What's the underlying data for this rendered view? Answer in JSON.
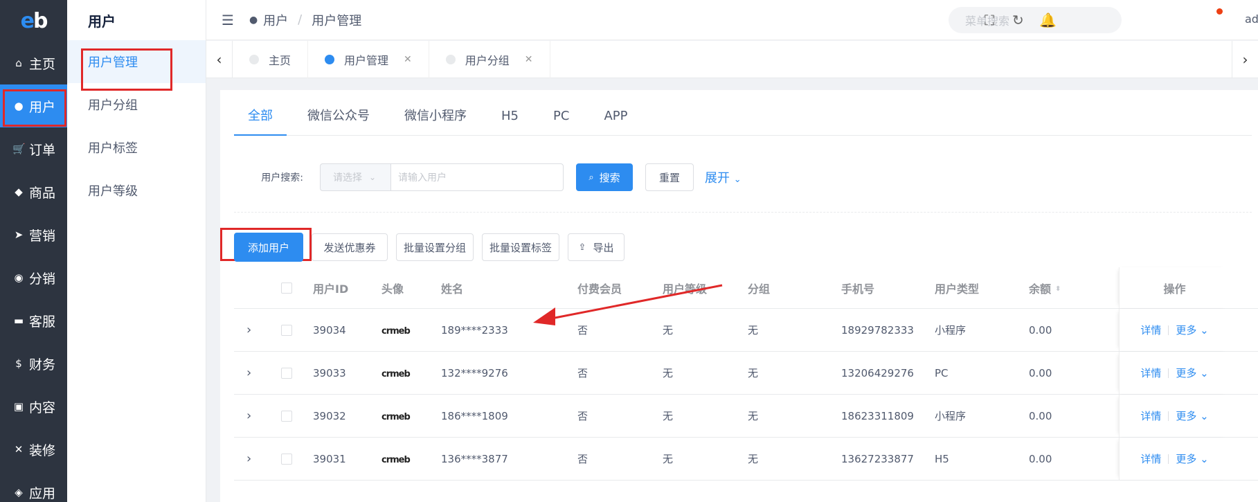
{
  "logo": {
    "text_e": "e",
    "text_b": "b"
  },
  "rail": [
    {
      "icon": "⌂",
      "label": "主页",
      "active": false
    },
    {
      "icon": "●",
      "label": "用户",
      "active": true
    },
    {
      "icon": "🛒",
      "label": "订单",
      "active": false
    },
    {
      "icon": "◆",
      "label": "商品",
      "active": false
    },
    {
      "icon": "➤",
      "label": "营销",
      "active": false
    },
    {
      "icon": "◉",
      "label": "分销",
      "active": false
    },
    {
      "icon": "▬",
      "label": "客服",
      "active": false
    },
    {
      "icon": "$",
      "label": "财务",
      "active": false
    },
    {
      "icon": "▣",
      "label": "内容",
      "active": false
    },
    {
      "icon": "✕",
      "label": "装修",
      "active": false
    },
    {
      "icon": "◈",
      "label": "应用",
      "active": false
    }
  ],
  "subnav": {
    "title": "用户",
    "items": [
      {
        "label": "用户管理",
        "active": true
      },
      {
        "label": "用户分组",
        "active": false
      },
      {
        "label": "用户标签",
        "active": false
      },
      {
        "label": "用户等级",
        "active": false
      }
    ]
  },
  "header": {
    "crumb_1": "用户",
    "crumb_sep": "/",
    "crumb_2": "用户管理",
    "search_placeholder": "菜单搜索",
    "user": "ad"
  },
  "page_tabs": [
    {
      "label": "主页",
      "active": false,
      "closable": false
    },
    {
      "label": "用户管理",
      "active": true,
      "closable": true
    },
    {
      "label": "用户分组",
      "active": false,
      "closable": true
    }
  ],
  "channel_tabs": [
    {
      "label": "全部",
      "active": true
    },
    {
      "label": "微信公众号",
      "active": false
    },
    {
      "label": "微信小程序",
      "active": false
    },
    {
      "label": "H5",
      "active": false
    },
    {
      "label": "PC",
      "active": false
    },
    {
      "label": "APP",
      "active": false
    }
  ],
  "search": {
    "label": "用户搜索:",
    "select_placeholder": "请选择",
    "input_placeholder": "请输入用户",
    "search_btn": "搜索",
    "reset_btn": "重置",
    "expand": "展开"
  },
  "actions": {
    "add_user": "添加用户",
    "send_coupon": "发送优惠券",
    "batch_group": "批量设置分组",
    "batch_tag": "批量设置标签",
    "export": "导出"
  },
  "table": {
    "headers": {
      "id": "用户ID",
      "avatar": "头像",
      "name": "姓名",
      "paid": "付费会员",
      "level": "用户等级",
      "group": "分组",
      "phone": "手机号",
      "type": "用户类型",
      "balance": "余额",
      "ops": "操作"
    },
    "avatar_text": "crmeb",
    "detail_label": "详情",
    "more_label": "更多",
    "rows": [
      {
        "id": "39034",
        "name": "189****2333",
        "paid": "否",
        "level": "无",
        "group": "无",
        "phone": "18929782333",
        "type": "小程序",
        "balance": "0.00"
      },
      {
        "id": "39033",
        "name": "132****9276",
        "paid": "否",
        "level": "无",
        "group": "无",
        "phone": "13206429276",
        "type": "PC",
        "balance": "0.00"
      },
      {
        "id": "39032",
        "name": "186****1809",
        "paid": "否",
        "level": "无",
        "group": "无",
        "phone": "18623311809",
        "type": "小程序",
        "balance": "0.00"
      },
      {
        "id": "39031",
        "name": "136****3877",
        "paid": "否",
        "level": "无",
        "group": "无",
        "phone": "13627233877",
        "type": "H5",
        "balance": "0.00"
      }
    ]
  },
  "colors": {
    "primary": "#2d8cf0",
    "rail_bg": "#2d3440",
    "highlight": "#e02828"
  }
}
